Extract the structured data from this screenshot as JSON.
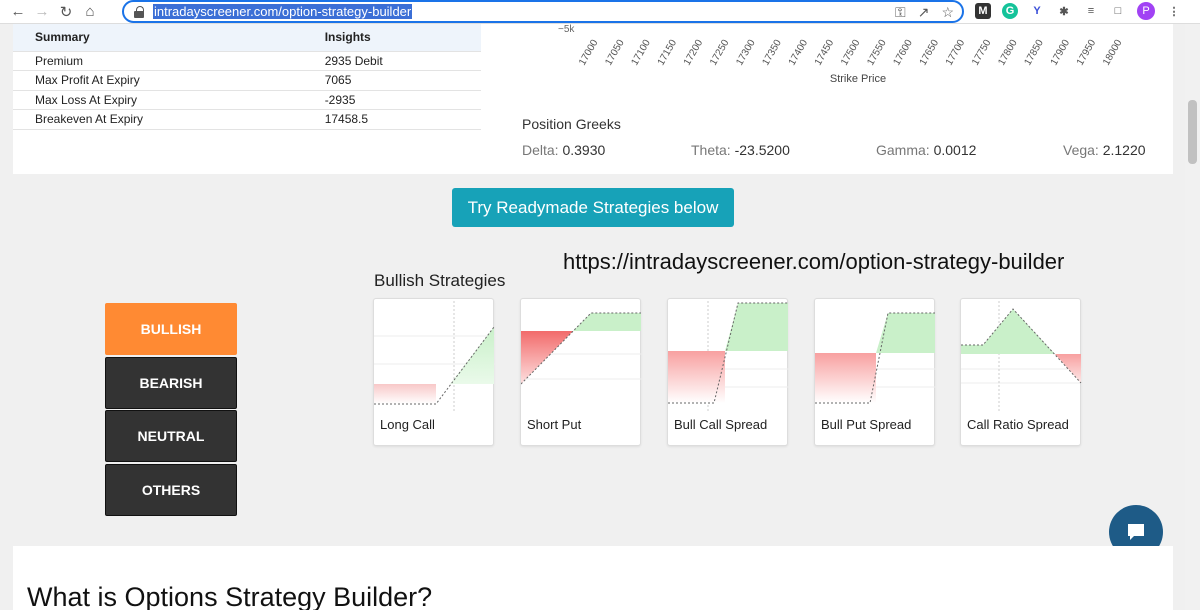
{
  "browser": {
    "url": "intradayscreener.com/option-strategy-builder",
    "profile_initial": "P"
  },
  "summary": {
    "headers": [
      "Summary",
      "Insights"
    ],
    "rows": [
      [
        "Premium",
        "2935 Debit"
      ],
      [
        "Max Profit At Expiry",
        "7065"
      ],
      [
        "Max Loss At Expiry",
        "-2935"
      ],
      [
        "Breakeven At Expiry",
        "17458.5"
      ]
    ]
  },
  "payoff_axis": {
    "y_tick_partial": "−5k",
    "x_ticks": [
      "17000",
      "17050",
      "17100",
      "17150",
      "17200",
      "17250",
      "17300",
      "17350",
      "17400",
      "17450",
      "17500",
      "17550",
      "17600",
      "17650",
      "17700",
      "17750",
      "17800",
      "17850",
      "17900",
      "17950",
      "18000"
    ],
    "x_title": "Strike Price"
  },
  "greeks": {
    "title": "Position Greeks",
    "delta_label": "Delta:",
    "delta_value": "0.3930",
    "theta_label": "Theta:",
    "theta_value": "-23.5200",
    "gamma_label": "Gamma:",
    "gamma_value": "0.0012",
    "vega_label": "Vega:",
    "vega_value": "2.1220"
  },
  "try_button": "Try Readymade Strategies below",
  "overlay_url": "https://intradayscreener.com/option-strategy-builder",
  "section_title": "Bullish Strategies",
  "categories": [
    "BULLISH",
    "BEARISH",
    "NEUTRAL",
    "OTHERS"
  ],
  "strategies": [
    {
      "name": "Long Call"
    },
    {
      "name": "Short Put"
    },
    {
      "name": "Bull Call Spread"
    },
    {
      "name": "Bull Put Spread"
    },
    {
      "name": "Call Ratio Spread"
    }
  ],
  "bottom_heading": "What is Options Strategy Builder?",
  "colors": {
    "accent_orange": "#ff8a33",
    "teal": "#17a2b8",
    "profit_green": "#c9f0c9",
    "loss_red": "#f26b6b",
    "chat": "#1e5b87"
  }
}
